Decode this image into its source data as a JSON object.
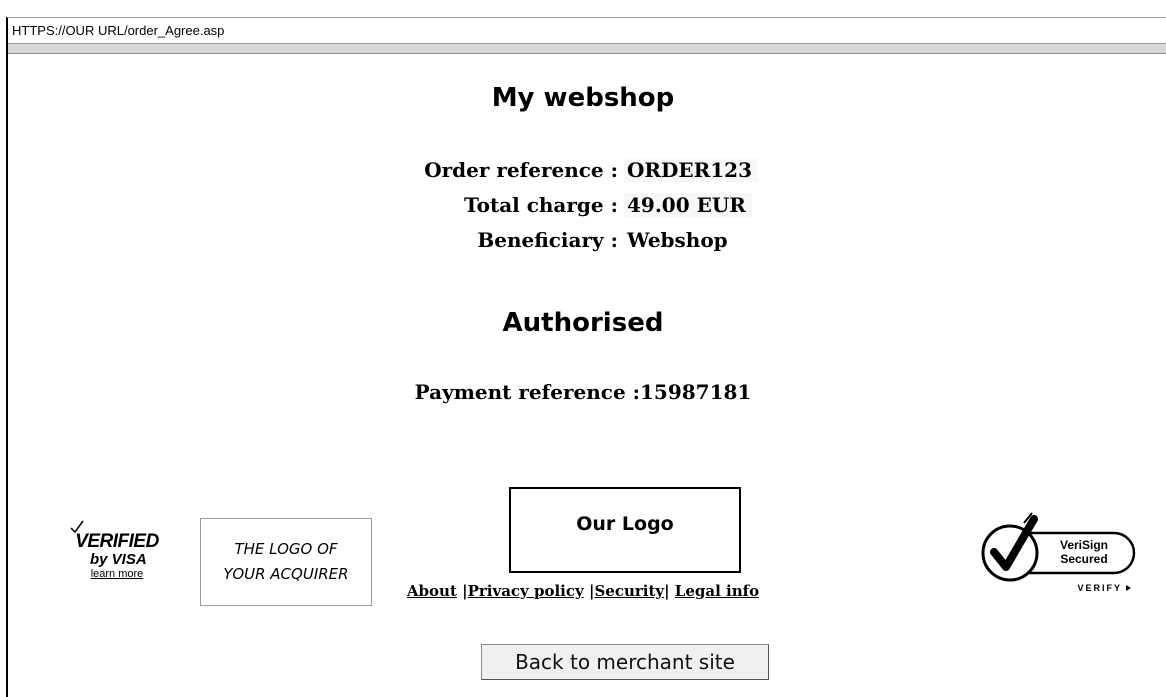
{
  "browser": {
    "url": "HTTPS://OUR URL/order_Agree.asp"
  },
  "page": {
    "title": "My webshop"
  },
  "order": [
    {
      "label": "Order reference :",
      "value": "ORDER123"
    },
    {
      "label": "Total charge :",
      "value": "49.00 EUR"
    },
    {
      "label": "Beneficiary :",
      "value": "Webshop"
    }
  ],
  "status": "Authorised",
  "payment_reference": "Payment reference :15987181",
  "badges": {
    "visa_line1": "VERIFIED",
    "visa_line2": "by VISA",
    "visa_learn": "learn more",
    "acquirer_line1": "THE LOGO OF",
    "acquirer_line2": "YOUR ACQUIRER",
    "our_logo": "Our Logo",
    "verisign_line1": "VeriSign",
    "verisign_line2": "Secured",
    "verisign_verify": "VERIFY"
  },
  "footer": {
    "about": "About",
    "privacy": "Privacy policy",
    "security": "Security",
    "legal": "Legal info"
  },
  "back_button": "Back to merchant site"
}
